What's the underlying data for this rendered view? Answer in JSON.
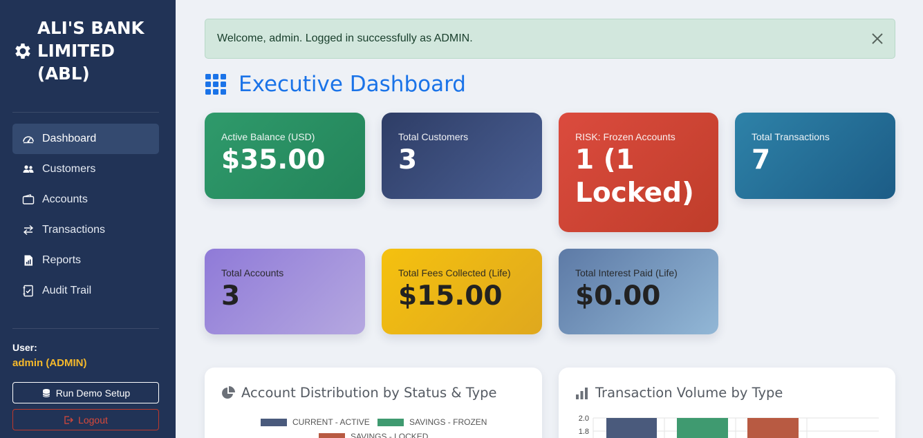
{
  "brand": {
    "title": "ALI'S BANK LIMITED (ABL)"
  },
  "sidebar": {
    "items": [
      {
        "label": "Dashboard",
        "icon": "dashboard-icon"
      },
      {
        "label": "Customers",
        "icon": "users-icon"
      },
      {
        "label": "Accounts",
        "icon": "wallet-icon"
      },
      {
        "label": "Transactions",
        "icon": "arrows-exchange-icon"
      },
      {
        "label": "Reports",
        "icon": "report-icon"
      },
      {
        "label": "Audit Trail",
        "icon": "checklist-icon"
      }
    ],
    "user_label": "User:",
    "user_name": "admin (ADMIN)",
    "demo_button": "Run Demo Setup",
    "logout_button": "Logout"
  },
  "alert": {
    "message": "Welcome, admin. Logged in successfully as ADMIN."
  },
  "page": {
    "title": "Executive Dashboard"
  },
  "cards": [
    {
      "label": "Active Balance (USD)",
      "value": "$35.00",
      "color": "#2f9a6b"
    },
    {
      "label": "Total Customers",
      "value": "3",
      "color": "#34467a"
    },
    {
      "label": "RISK: Frozen Accounts",
      "value": "1 (1 Locked)",
      "color": "#d2443a"
    },
    {
      "label": "Total Transactions",
      "value": "7",
      "color": "#24739b"
    },
    {
      "label": "Total Accounts",
      "value": "3",
      "color": "#a394dc"
    },
    {
      "label": "Total Fees Collected (Life)",
      "value": "$15.00",
      "color": "#ebb518"
    },
    {
      "label": "Total Interest Paid (Life)",
      "value": "$0.00",
      "color": "#7898bf"
    }
  ],
  "panels": {
    "distribution": {
      "title": "Account Distribution by Status & Type",
      "legend": [
        {
          "label": "CURRENT - ACTIVE",
          "color": "#4a5a7c"
        },
        {
          "label": "SAVINGS - FROZEN",
          "color": "#3f9a70"
        },
        {
          "label": "SAVINGS - LOCKED",
          "color": "#b85a42"
        }
      ]
    },
    "volume": {
      "title": "Transaction Volume by Type",
      "y_ticks": [
        "2.0",
        "1.8"
      ],
      "bar_colors": [
        "#4a5a7c",
        "#3f9a70",
        "#b85a42"
      ]
    }
  }
}
